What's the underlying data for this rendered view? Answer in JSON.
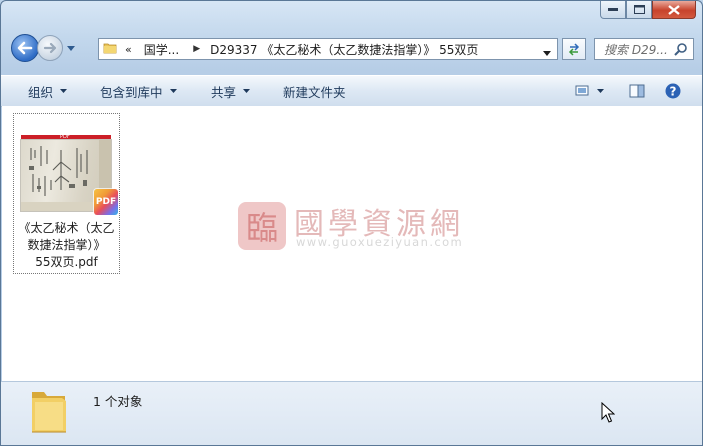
{
  "window": {
    "caption_buttons": [
      "minimize",
      "maximize",
      "close"
    ]
  },
  "address_bar": {
    "overflow": "«",
    "segments": [
      "国学...",
      "D29337 《太乙秘术（太乙数捷法指掌）》 55双页"
    ]
  },
  "search": {
    "placeholder": "搜索 D29..."
  },
  "toolbar": {
    "organize": "组织",
    "include_in_library": "包含到库中",
    "share": "共享",
    "new_folder": "新建文件夹"
  },
  "files": [
    {
      "name_lines": [
        "《太乙秘术（太乙",
        "数捷法指掌）》",
        "55双页.pdf"
      ],
      "thumb_header": "PDF",
      "badge": "PDF"
    }
  ],
  "watermark": {
    "title": "國學資源網",
    "url": "www.guoxueziyuan.com",
    "logo_glyph": "臨"
  },
  "details": {
    "count_text": "1 个对象"
  },
  "colors": {
    "frame": "#bcd3ea",
    "close_button": "#c7432c",
    "pdf_bar": "#cc1f27"
  }
}
